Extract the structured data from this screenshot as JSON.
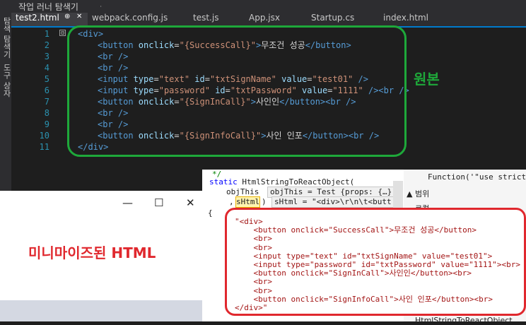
{
  "top_bar": {
    "title": "작업 러너 탐색기",
    "pin": "ᅟ ᆞ"
  },
  "left_bar": {
    "label_top": "탐색 탐색기",
    "label_bottom": "도구 상자"
  },
  "tabs": [
    {
      "label": "test2.html",
      "active": true,
      "pin": "⊕",
      "close": "✕"
    },
    {
      "label": "webpack.config.js"
    },
    {
      "label": "test.js"
    },
    {
      "label": "App.jsx"
    },
    {
      "label": "Startup.cs"
    },
    {
      "label": "index.html"
    }
  ],
  "editor": {
    "line_numbers": [
      "1",
      "2",
      "3",
      "4",
      "5",
      "6",
      "7",
      "8",
      "9",
      "10",
      "11"
    ],
    "fold_glyph": "⊟",
    "lines": [
      [
        [
          "t",
          "<div>"
        ]
      ],
      [
        [
          "t",
          "<button "
        ],
        [
          "a",
          "onclick"
        ],
        [
          "x",
          "="
        ],
        [
          "v",
          "\"{SuccessCall}\""
        ],
        [
          "t",
          ">"
        ],
        [
          "x",
          "무조건 성공"
        ],
        [
          "t",
          "</button>"
        ]
      ],
      [
        [
          "t",
          "<br />"
        ]
      ],
      [
        [
          "t",
          "<br />"
        ]
      ],
      [
        [
          "t",
          "<input "
        ],
        [
          "a",
          "type"
        ],
        [
          "x",
          "="
        ],
        [
          "v",
          "\"text\" "
        ],
        [
          "a",
          "id"
        ],
        [
          "x",
          "="
        ],
        [
          "v",
          "\"txtSignName\" "
        ],
        [
          "a",
          "value"
        ],
        [
          "x",
          "="
        ],
        [
          "v",
          "\"test01\" "
        ],
        [
          "t",
          "/>"
        ]
      ],
      [
        [
          "t",
          "<input "
        ],
        [
          "a",
          "type"
        ],
        [
          "x",
          "="
        ],
        [
          "v",
          "\"password\" "
        ],
        [
          "a",
          "id"
        ],
        [
          "x",
          "="
        ],
        [
          "v",
          "\"txtPassword\" "
        ],
        [
          "a",
          "value"
        ],
        [
          "x",
          "="
        ],
        [
          "v",
          "\"1111\" "
        ],
        [
          "t",
          "/><br />"
        ]
      ],
      [
        [
          "t",
          "<button "
        ],
        [
          "a",
          "onclick"
        ],
        [
          "x",
          "="
        ],
        [
          "v",
          "\"{SignInCall}\""
        ],
        [
          "t",
          ">"
        ],
        [
          "x",
          "사인인"
        ],
        [
          "t",
          "</button><br />"
        ]
      ],
      [
        [
          "t",
          "<br />"
        ]
      ],
      [
        [
          "t",
          "<br />"
        ]
      ],
      [
        [
          "t",
          "<button "
        ],
        [
          "a",
          "onclick"
        ],
        [
          "x",
          "="
        ],
        [
          "v",
          "\"{SignInfoCall}\""
        ],
        [
          "t",
          ">"
        ],
        [
          "x",
          "사인 인포"
        ],
        [
          "t",
          "</button><br />"
        ]
      ],
      [
        [
          "t",
          "</div>"
        ]
      ]
    ],
    "annotation": "원본"
  },
  "window_panel": {
    "minimize": "—",
    "maximize": "☐",
    "close": "✕",
    "label": "미니마이즈된 HTML"
  },
  "mid_panel": {
    "comment": "*/",
    "sig_static": "static ",
    "sig_rest": "HtmlStringToReactObject(",
    "param1": "objThis",
    "param1_tip": "objThis = Test {props: {…}",
    "comma": ", ",
    "param2": "sHtml",
    "paren": ")",
    "param2_tip": "sHtml = \"<div>\\r\\n\\t<butt",
    "brace": "{"
  },
  "right_panel": {
    "function_text": "Function('\"use strict",
    "range_label": "▲ 범위",
    "local_label": "로컬",
    "bottom_text": "HtmlStringToReactObject"
  },
  "red_box": {
    "lines": [
      "\"<div>",
      "    <button onclick=\"SuccessCall\">무조건 성공</button>",
      "    <br>",
      "    <br>",
      "    <input type=\"text\" id=\"txtSignName\" value=\"test01\">",
      "    <input type=\"password\" id=\"txtPassword\" value=\"1111\"><br>",
      "    <button onclick=\"SignInCall\">사인인</button><br>",
      "    <br>",
      "    <br>",
      "    <button onclick=\"SignInfoCall\">사인 인포</button><br>",
      "</div>\""
    ]
  }
}
